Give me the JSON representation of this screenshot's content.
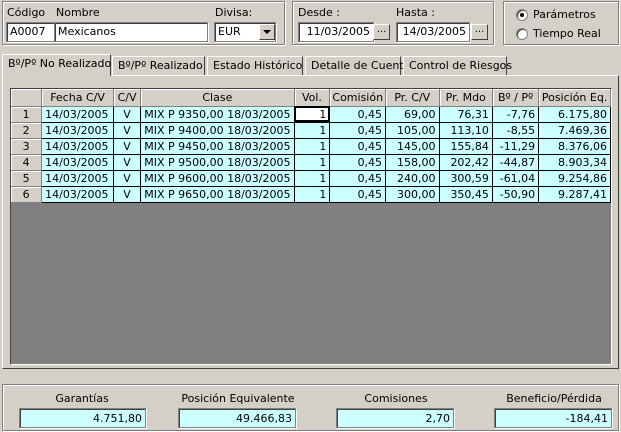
{
  "filters": {
    "codigo_label": "Código",
    "codigo_value": "A0007",
    "nombre_label": "Nombre",
    "nombre_value": "Mexicanos",
    "divisa_label": "Divisa:",
    "divisa_value": "EUR"
  },
  "dates": {
    "desde_label": "Desde :",
    "desde_value": "11/03/2005",
    "hasta_label": "Hasta :",
    "hasta_value": "14/03/2005",
    "picker_label": "..."
  },
  "mode": {
    "option1": "Parámetros",
    "option2": "Tiempo Real",
    "selected": "Parámetros"
  },
  "tabs": [
    {
      "label": "Bº/Pº No Realizado"
    },
    {
      "label": "Bº/Pº Realizado"
    },
    {
      "label": "Estado Histórico"
    },
    {
      "label": "Detalle de Cuenta"
    },
    {
      "label": "Control de Riesgos"
    }
  ],
  "table": {
    "headers": [
      "",
      "Fecha C/V",
      "C/V",
      "Clase",
      "Vol.",
      "Comisión",
      "Pr. C/V",
      "Pr. Mdo",
      "Bº / Pº",
      "Posición Eq."
    ],
    "rows": [
      [
        "1",
        "14/03/2005",
        "V",
        "MIX P 9350,00 18/03/2005",
        "1",
        "0,45",
        "69,00",
        "76,31",
        "-7,76",
        "6.175,80"
      ],
      [
        "2",
        "14/03/2005",
        "V",
        "MIX P 9400,00 18/03/2005",
        "1",
        "0,45",
        "105,00",
        "113,10",
        "-8,55",
        "7.469,36"
      ],
      [
        "3",
        "14/03/2005",
        "V",
        "MIX P 9450,00 18/03/2005",
        "1",
        "0,45",
        "145,00",
        "155,84",
        "-11,29",
        "8.376,06"
      ],
      [
        "4",
        "14/03/2005",
        "V",
        "MIX P 9500,00 18/03/2005",
        "1",
        "0,45",
        "158,00",
        "202,42",
        "-44,87",
        "8.903,34"
      ],
      [
        "5",
        "14/03/2005",
        "V",
        "MIX P 9600,00 18/03/2005",
        "1",
        "0,45",
        "240,00",
        "300,59",
        "-61,04",
        "9.254,86"
      ],
      [
        "6",
        "14/03/2005",
        "V",
        "MIX P 9650,00 18/03/2005",
        "1",
        "0,45",
        "300,00",
        "350,45",
        "-50,90",
        "9.287,41"
      ]
    ]
  },
  "summary": {
    "garantias_label": "Garantías",
    "garantias_value": "4.751,80",
    "posicion_label": "Posición Equivalente",
    "posicion_value": "49.466,83",
    "comisiones_label": "Comisiones",
    "comisiones_value": "2,70",
    "beneficio_label": "Beneficio/Pérdida",
    "beneficio_value": "-184,41"
  },
  "colors": {
    "background": "#d4d0c8",
    "cell_fill": "#ccffff"
  }
}
